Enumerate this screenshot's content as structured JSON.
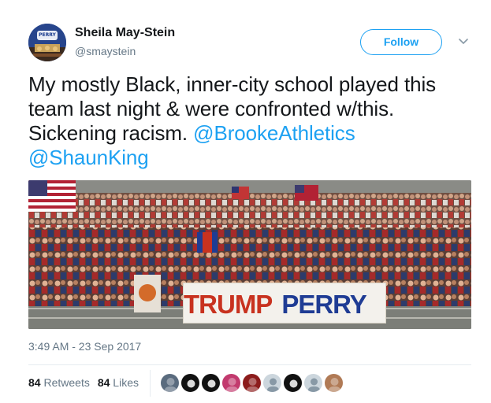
{
  "tweet": {
    "author": {
      "display_name": "Sheila May-Stein",
      "handle": "@smaystein",
      "avatar_badge": "PERRY"
    },
    "follow_label": "Follow",
    "text_plain": "My mostly Black, inner-city school played this team last night & were confronted w/this. Sickening racism. ",
    "mentions": [
      "@BrookeAthletics",
      "@ShaunKing"
    ],
    "photo": {
      "sign_word_1": "TRUMP",
      "sign_word_2": "PERRY"
    },
    "timestamp": "3:49 AM - 23 Sep 2017",
    "stats": {
      "retweets_count": "84",
      "retweets_label": "Retweets",
      "likes_count": "84",
      "likes_label": "Likes"
    },
    "likers": [
      {
        "name": "liker-1",
        "color": "#5a6b7e"
      },
      {
        "name": "liker-2",
        "color": "#111111"
      },
      {
        "name": "liker-3",
        "color": "#111111"
      },
      {
        "name": "liker-4",
        "color": "#c23a6e"
      },
      {
        "name": "liker-5",
        "color": "#8c1c1c"
      },
      {
        "name": "liker-6",
        "color": "#ccd6dd"
      },
      {
        "name": "liker-7",
        "color": "#111111"
      },
      {
        "name": "liker-8",
        "color": "#ccd6dd"
      },
      {
        "name": "liker-9",
        "color": "#b07a55"
      }
    ]
  },
  "colors": {
    "accent": "#1da1f2",
    "text": "#14171a",
    "muted": "#657786"
  }
}
